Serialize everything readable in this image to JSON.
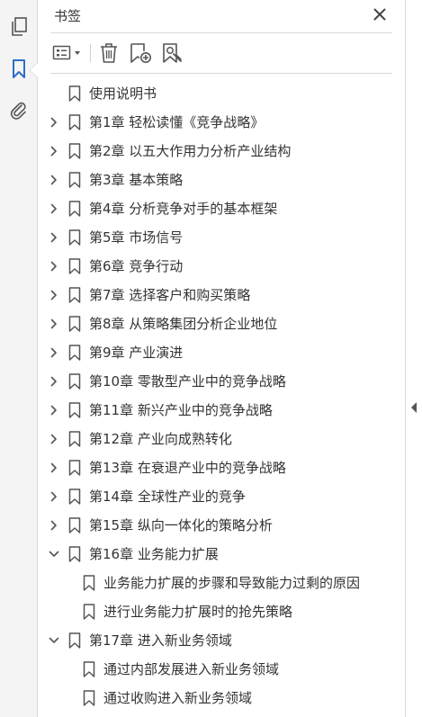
{
  "panel": {
    "title": "书签"
  },
  "rail": {
    "icons": [
      "pages-icon",
      "bookmark-icon",
      "attachment-icon"
    ]
  },
  "toolbar": {
    "icons": [
      "options-menu-icon",
      "delete-icon",
      "new-bookmark-icon",
      "bookmark-from-structure-icon"
    ]
  },
  "bookmarks": [
    {
      "label": "使用说明书",
      "level": 0,
      "state": "none"
    },
    {
      "label": "第1章  轻松读懂《竞争战略》",
      "level": 0,
      "state": "collapsed"
    },
    {
      "label": "第2章  以五大作用力分析产业结构",
      "level": 0,
      "state": "collapsed"
    },
    {
      "label": "第3章  基本策略",
      "level": 0,
      "state": "collapsed"
    },
    {
      "label": "第4章  分析竞争对手的基本框架",
      "level": 0,
      "state": "collapsed"
    },
    {
      "label": "第5章  市场信号",
      "level": 0,
      "state": "collapsed"
    },
    {
      "label": "第6章  竞争行动",
      "level": 0,
      "state": "collapsed"
    },
    {
      "label": "第7章  选择客户和购买策略",
      "level": 0,
      "state": "collapsed"
    },
    {
      "label": "第8章  从策略集团分析企业地位",
      "level": 0,
      "state": "collapsed"
    },
    {
      "label": "第9章  产业演进",
      "level": 0,
      "state": "collapsed"
    },
    {
      "label": "第10章  零散型产业中的竞争战略",
      "level": 0,
      "state": "collapsed"
    },
    {
      "label": "第11章  新兴产业中的竞争战略",
      "level": 0,
      "state": "collapsed"
    },
    {
      "label": "第12章  产业向成熟转化",
      "level": 0,
      "state": "collapsed"
    },
    {
      "label": "第13章  在衰退产业中的竞争战略",
      "level": 0,
      "state": "collapsed"
    },
    {
      "label": "第14章  全球性产业的竞争",
      "level": 0,
      "state": "collapsed"
    },
    {
      "label": "第15章  纵向一体化的策略分析",
      "level": 0,
      "state": "collapsed"
    },
    {
      "label": "第16章  业务能力扩展",
      "level": 0,
      "state": "expanded"
    },
    {
      "label": "业务能力扩展的步骤和导致能力过剩的原因",
      "level": 1,
      "state": "none"
    },
    {
      "label": "进行业务能力扩展时的抢先策略",
      "level": 1,
      "state": "none"
    },
    {
      "label": "第17章  进入新业务领域",
      "level": 0,
      "state": "expanded"
    },
    {
      "label": "通过内部发展进入新业务领域",
      "level": 1,
      "state": "none"
    },
    {
      "label": "通过收购进入新业务领域",
      "level": 1,
      "state": "none"
    }
  ],
  "colors": {
    "rail_bg": "#f4f4f4",
    "text": "#333333",
    "icon": "#555555",
    "accent": "#2d6fc7",
    "border": "#d9d9d9"
  }
}
